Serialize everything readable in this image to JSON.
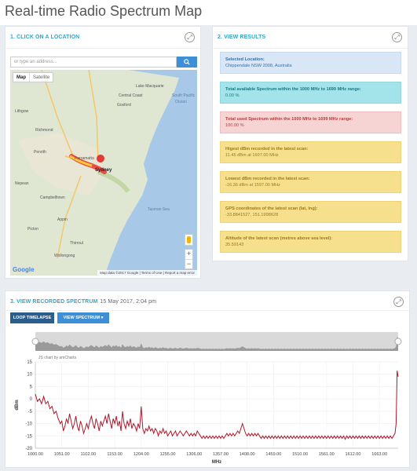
{
  "page": {
    "title": "Real-time Radio Spectrum Map"
  },
  "location_panel": {
    "title": "1. CLICK ON A LOCATION",
    "search": {
      "placeholder": "or type an address..."
    },
    "map": {
      "toggle_map": "Map",
      "toggle_satellite": "Satellite",
      "labels": {
        "central_coast": "Central Coast",
        "gosford": "Gosford",
        "richmond": "Richmond",
        "penrith": "Penrith",
        "parramatta": "Parramatta",
        "sydney": "Sydney",
        "campbelltown": "Campbelltown",
        "wollongong": "Wollongong",
        "lake_macquarie": "Lake Macquarie",
        "south_pacific": "South Pacific",
        "ocean": "Ocean",
        "tasman_sea": "Tasman Sea",
        "appin": "Appin",
        "picton": "Picton",
        "thirroul": "Thirroul",
        "nepean": "Nepean",
        "lithgow": "Lithgow"
      },
      "google_logo": "Google",
      "credit": "Map data ©2017 Google | Terms of Use | Report a map error"
    }
  },
  "results_panel": {
    "title": "2. VIEW RESULTS",
    "cards": [
      {
        "style": "blue",
        "label": "Selected Location:",
        "value": "Chippendale NSW 2008, Australia"
      },
      {
        "style": "cyan",
        "label": "Total available Spectrum within the 1000 MHz to 1699 MHz range:",
        "value": "0.00 %"
      },
      {
        "style": "pink",
        "label": "Total used Spectrum within the 1000 MHz to 1699 MHz range:",
        "value": "100.00 %"
      },
      {
        "style": "yellow",
        "label": "Higest dBm recorded in the latest scan:",
        "value": "11.45 dBm at 1697.00 MHz"
      },
      {
        "style": "yellow",
        "label": "Lowest dBm recorded in the latest scan:",
        "value": "-16.36 dBm at 1597.00 MHz"
      },
      {
        "style": "yellow",
        "label": "GPS coordinates of the latest scan (lat, lng):",
        "value": "-33.8841527, 151.1998628"
      },
      {
        "style": "yellow",
        "label": "Altitude of the latest scan (metres above sea level):",
        "value": "35.59143"
      }
    ]
  },
  "spectrum_panel": {
    "title": "3. VIEW RECORDED SPECTRUM",
    "timestamp": "15 May 2017, 2:04 pm",
    "loop_button": "LOOP TIMELAPSE",
    "view_button": "VIEW SPECTRUM",
    "credit": "JS chart by amCharts"
  },
  "colors": {
    "accent": "#32a6c8",
    "button_dark": "#2b5e8c",
    "button_blue": "#3d8fd8",
    "line": "#b0172a"
  },
  "chart_data": {
    "type": "line",
    "xlabel": "MHz",
    "ylabel": "dBm",
    "xlim": [
      1000,
      1699
    ],
    "ylim": [
      -20,
      15
    ],
    "yticks": [
      15,
      10,
      5,
      0,
      -5,
      -10,
      -15,
      -20
    ],
    "xticks": [
      "1000.00",
      "1051.00",
      "1102.00",
      "1153.00",
      "1204.00",
      "1255.00",
      "1306.00",
      "1357.00",
      "1408.00",
      "1459.00",
      "1510.00",
      "1561.00",
      "1612.00",
      "1663.00"
    ],
    "grid": true,
    "series": [
      {
        "values": [
          [
            1000,
            2
          ],
          [
            1004,
            -1
          ],
          [
            1008,
            0
          ],
          [
            1012,
            -2
          ],
          [
            1016,
            1
          ],
          [
            1020,
            -2
          ],
          [
            1024,
            -1
          ],
          [
            1028,
            -4
          ],
          [
            1032,
            -3
          ],
          [
            1036,
            -6
          ],
          [
            1040,
            -5
          ],
          [
            1044,
            -8
          ],
          [
            1048,
            -10
          ],
          [
            1051,
            -9
          ],
          [
            1054,
            -13
          ],
          [
            1057,
            -11
          ],
          [
            1060,
            -8
          ],
          [
            1063,
            -10
          ],
          [
            1066,
            -6
          ],
          [
            1069,
            -9
          ],
          [
            1072,
            -12
          ],
          [
            1075,
            -10
          ],
          [
            1078,
            -7
          ],
          [
            1081,
            -11
          ],
          [
            1084,
            -13
          ],
          [
            1087,
            -9
          ],
          [
            1090,
            -11
          ],
          [
            1093,
            -14
          ],
          [
            1096,
            -12
          ],
          [
            1099,
            -10
          ],
          [
            1102,
            -12
          ],
          [
            1105,
            -9
          ],
          [
            1108,
            -7
          ],
          [
            1111,
            -10
          ],
          [
            1114,
            -12
          ],
          [
            1117,
            -8
          ],
          [
            1120,
            -10
          ],
          [
            1123,
            -13
          ],
          [
            1126,
            -9
          ],
          [
            1129,
            -11
          ],
          [
            1132,
            -9
          ],
          [
            1135,
            -7
          ],
          [
            1138,
            -10
          ],
          [
            1141,
            -6
          ],
          [
            1144,
            -9
          ],
          [
            1147,
            -12
          ],
          [
            1150,
            -8
          ],
          [
            1153,
            -10
          ],
          [
            1156,
            -7
          ],
          [
            1159,
            -11
          ],
          [
            1162,
            -9
          ],
          [
            1165,
            -13
          ],
          [
            1168,
            -5
          ],
          [
            1171,
            -10
          ],
          [
            1174,
            -12
          ],
          [
            1177,
            -9
          ],
          [
            1180,
            -11
          ],
          [
            1183,
            -8
          ],
          [
            1186,
            -12
          ],
          [
            1189,
            -10
          ],
          [
            1192,
            -11
          ],
          [
            1195,
            -13
          ],
          [
            1198,
            -10
          ],
          [
            1201,
            -12
          ],
          [
            1204,
            -3
          ],
          [
            1207,
            -12
          ],
          [
            1210,
            -14
          ],
          [
            1213,
            -12
          ],
          [
            1216,
            -13
          ],
          [
            1219,
            -11
          ],
          [
            1222,
            -13
          ],
          [
            1225,
            -12
          ],
          [
            1228,
            -14
          ],
          [
            1231,
            -12
          ],
          [
            1234,
            -13
          ],
          [
            1237,
            -15
          ],
          [
            1240,
            -13
          ],
          [
            1243,
            -14
          ],
          [
            1246,
            -12
          ],
          [
            1249,
            -14
          ],
          [
            1252,
            -13
          ],
          [
            1255,
            -15
          ],
          [
            1258,
            -14
          ],
          [
            1261,
            -13
          ],
          [
            1264,
            -15
          ],
          [
            1267,
            -14
          ],
          [
            1270,
            -13
          ],
          [
            1273,
            -15
          ],
          [
            1276,
            -14
          ],
          [
            1279,
            -13
          ],
          [
            1282,
            -14
          ],
          [
            1285,
            -15
          ],
          [
            1288,
            -14
          ],
          [
            1291,
            -13
          ],
          [
            1294,
            -14
          ],
          [
            1297,
            -15
          ],
          [
            1300,
            -14
          ],
          [
            1303,
            -15
          ],
          [
            1306,
            -14
          ],
          [
            1309,
            -15
          ],
          [
            1312,
            -13
          ],
          [
            1315,
            -14
          ],
          [
            1318,
            -15
          ],
          [
            1321,
            -16
          ],
          [
            1324,
            -15
          ],
          [
            1327,
            -16
          ],
          [
            1330,
            -15
          ],
          [
            1333,
            -16
          ],
          [
            1336,
            -15
          ],
          [
            1339,
            -16
          ],
          [
            1342,
            -15
          ],
          [
            1345,
            -16
          ],
          [
            1348,
            -15
          ],
          [
            1351,
            -16
          ],
          [
            1354,
            -15
          ],
          [
            1357,
            -16
          ],
          [
            1360,
            -15
          ],
          [
            1363,
            -16
          ],
          [
            1366,
            -15
          ],
          [
            1369,
            -14
          ],
          [
            1372,
            -15
          ],
          [
            1375,
            -14
          ],
          [
            1378,
            -15
          ],
          [
            1381,
            -14
          ],
          [
            1384,
            -15
          ],
          [
            1387,
            -14
          ],
          [
            1390,
            -13
          ],
          [
            1393,
            -14
          ],
          [
            1396,
            -12
          ],
          [
            1399,
            -10
          ],
          [
            1402,
            -12
          ],
          [
            1405,
            -14
          ],
          [
            1408,
            -15
          ],
          [
            1411,
            -14
          ],
          [
            1414,
            -15
          ],
          [
            1417,
            -14
          ],
          [
            1420,
            -15
          ],
          [
            1423,
            -14
          ],
          [
            1426,
            -15
          ],
          [
            1429,
            -14
          ],
          [
            1432,
            -15
          ],
          [
            1435,
            -16
          ],
          [
            1438,
            -15
          ],
          [
            1441,
            -16
          ],
          [
            1444,
            -15
          ],
          [
            1447,
            -16
          ],
          [
            1450,
            -15
          ],
          [
            1453,
            -16
          ],
          [
            1456,
            -15
          ],
          [
            1459,
            -16
          ],
          [
            1462,
            -15
          ],
          [
            1465,
            -16
          ],
          [
            1468,
            -15
          ],
          [
            1471,
            -16
          ],
          [
            1474,
            -15
          ],
          [
            1477,
            -16
          ],
          [
            1480,
            -15
          ],
          [
            1483,
            -16
          ],
          [
            1486,
            -15
          ],
          [
            1489,
            -16
          ],
          [
            1492,
            -15
          ],
          [
            1495,
            -16
          ],
          [
            1498,
            -15
          ],
          [
            1501,
            -16
          ],
          [
            1504,
            -15
          ],
          [
            1507,
            -16
          ],
          [
            1510,
            -15
          ],
          [
            1513,
            -16
          ],
          [
            1516,
            -15
          ],
          [
            1519,
            -16
          ],
          [
            1522,
            -15
          ],
          [
            1525,
            -16
          ],
          [
            1528,
            -15
          ],
          [
            1531,
            -16
          ],
          [
            1534,
            -15
          ],
          [
            1537,
            -16
          ],
          [
            1540,
            -15
          ],
          [
            1543,
            -16
          ],
          [
            1546,
            -15
          ],
          [
            1549,
            -16
          ],
          [
            1552,
            -15
          ],
          [
            1555,
            -16
          ],
          [
            1558,
            -15
          ],
          [
            1561,
            -16
          ],
          [
            1564,
            -15
          ],
          [
            1567,
            -16
          ],
          [
            1570,
            -15
          ],
          [
            1573,
            -16
          ],
          [
            1576,
            -15
          ],
          [
            1579,
            -16
          ],
          [
            1582,
            -15
          ],
          [
            1585,
            -16
          ],
          [
            1588,
            -15
          ],
          [
            1591,
            -16
          ],
          [
            1594,
            -15
          ],
          [
            1597,
            -16.36
          ],
          [
            1600,
            -15
          ],
          [
            1603,
            -16
          ],
          [
            1606,
            -15
          ],
          [
            1609,
            -16
          ],
          [
            1612,
            -15
          ],
          [
            1615,
            -16
          ],
          [
            1618,
            -15
          ],
          [
            1621,
            -16
          ],
          [
            1624,
            -15
          ],
          [
            1627,
            -16
          ],
          [
            1630,
            -15
          ],
          [
            1633,
            -16
          ],
          [
            1636,
            -15
          ],
          [
            1639,
            -16
          ],
          [
            1642,
            -15
          ],
          [
            1645,
            -16
          ],
          [
            1648,
            -15
          ],
          [
            1651,
            -16
          ],
          [
            1654,
            -15
          ],
          [
            1657,
            -16
          ],
          [
            1660,
            -15
          ],
          [
            1663,
            -16
          ],
          [
            1666,
            -15
          ],
          [
            1669,
            -16
          ],
          [
            1672,
            -15
          ],
          [
            1675,
            -16
          ],
          [
            1678,
            -15
          ],
          [
            1681,
            -16
          ],
          [
            1684,
            -15
          ],
          [
            1687,
            -16
          ],
          [
            1690,
            -15
          ],
          [
            1693,
            -14
          ],
          [
            1695,
            -10
          ],
          [
            1697,
            11.45
          ],
          [
            1699,
            9
          ]
        ]
      }
    ]
  }
}
